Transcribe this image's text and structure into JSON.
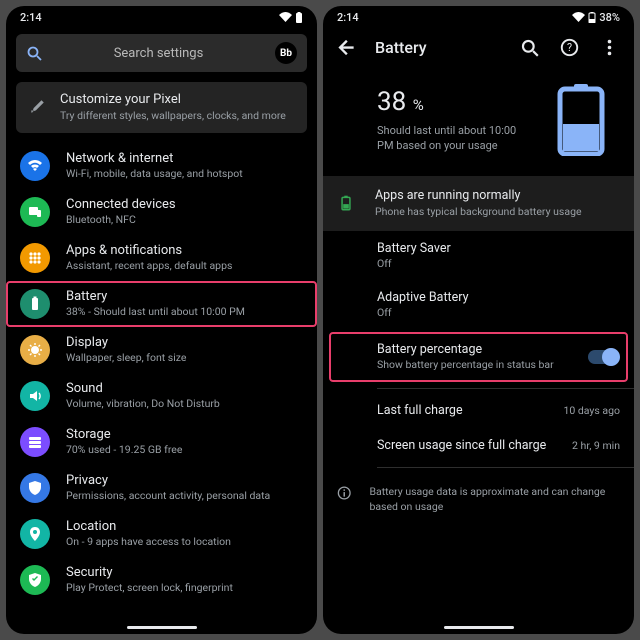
{
  "status": {
    "time": "2:14",
    "pct_text": "38%"
  },
  "left": {
    "search_placeholder": "Search settings",
    "avatar": "Bb",
    "hero": {
      "title": "Customize your Pixel",
      "sub": "Try different styles, wallpapers, clocks, and more"
    },
    "items": [
      {
        "title": "Network & internet",
        "sub": "Wi-Fi, mobile, data usage, and hotspot",
        "color": "#1a73e8",
        "icon": "wifi"
      },
      {
        "title": "Connected devices",
        "sub": "Bluetooth, NFC",
        "color": "#1db954",
        "icon": "devices"
      },
      {
        "title": "Apps & notifications",
        "sub": "Assistant, recent apps, default apps",
        "color": "#f29900",
        "icon": "apps"
      },
      {
        "title": "Battery",
        "sub": "38% - Should last until about 10:00 PM",
        "color": "#1e8e6e",
        "icon": "battery",
        "highlight": true
      },
      {
        "title": "Display",
        "sub": "Wallpaper, sleep, font size",
        "color": "#e8ae46",
        "icon": "display"
      },
      {
        "title": "Sound",
        "sub": "Volume, vibration, Do Not Disturb",
        "color": "#12b5a5",
        "icon": "sound"
      },
      {
        "title": "Storage",
        "sub": "70% used - 19.25 GB free",
        "color": "#7c4dff",
        "icon": "storage"
      },
      {
        "title": "Privacy",
        "sub": "Permissions, account activity, personal data",
        "color": "#3578e5",
        "icon": "privacy"
      },
      {
        "title": "Location",
        "sub": "On - 9 apps have access to location",
        "color": "#12b5a5",
        "icon": "location"
      },
      {
        "title": "Security",
        "sub": "Play Protect, screen lock, fingerprint",
        "color": "#1db954",
        "icon": "security"
      }
    ]
  },
  "right": {
    "title": "Battery",
    "pct": "38",
    "pct_unit": "%",
    "hero_sub": "Should last until about 10:00 PM based on your usage",
    "card": {
      "title": "Apps are running normally",
      "sub": "Phone has typical background battery usage"
    },
    "rows": [
      {
        "title": "Battery Saver",
        "sub": "Off"
      },
      {
        "title": "Adaptive Battery",
        "sub": "Off"
      },
      {
        "title": "Battery percentage",
        "sub": "Show battery percentage in status bar",
        "toggle": true,
        "highlight": true
      }
    ],
    "last_charge": {
      "title": "Last full charge",
      "value": "10 days ago"
    },
    "screen_usage": {
      "title": "Screen usage since full charge",
      "value": "2 hr, 9 min"
    },
    "info": "Battery usage data is approximate and can change based on usage"
  }
}
